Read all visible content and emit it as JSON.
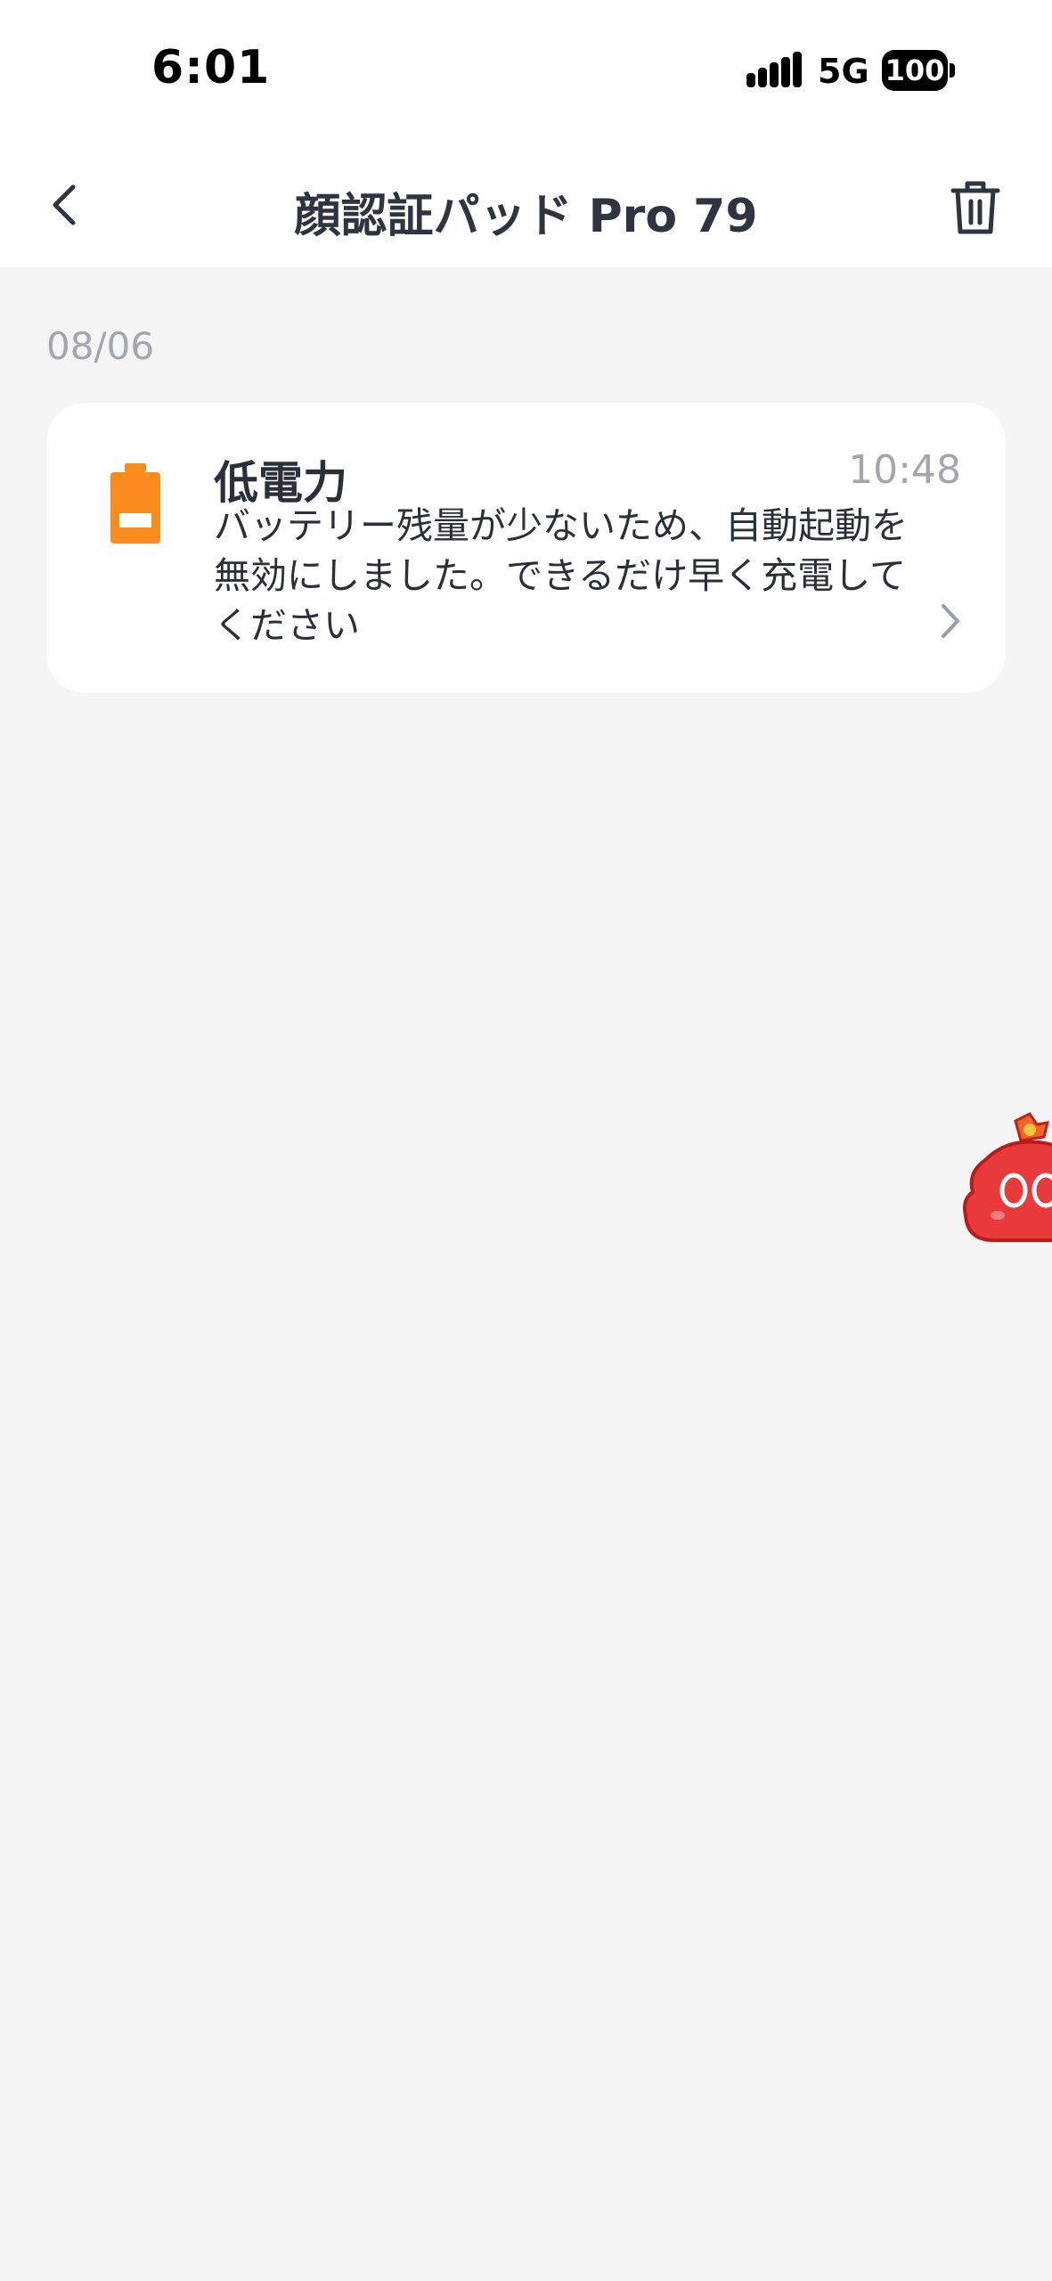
{
  "status_bar": {
    "time": "6:01",
    "network": "5G",
    "battery": "100"
  },
  "nav": {
    "title": "顔認証パッド Pro 79"
  },
  "date_group": "08/06",
  "notification": {
    "title": "低電力",
    "time": "10:48",
    "message": "バッテリー残量が少ないため、自動起動を無効にしました。できるだけ早く充電してください",
    "icon": "battery-low-icon"
  },
  "colors": {
    "accent_orange": "#fa8c1e",
    "mascot_red": "#e83a3a"
  }
}
